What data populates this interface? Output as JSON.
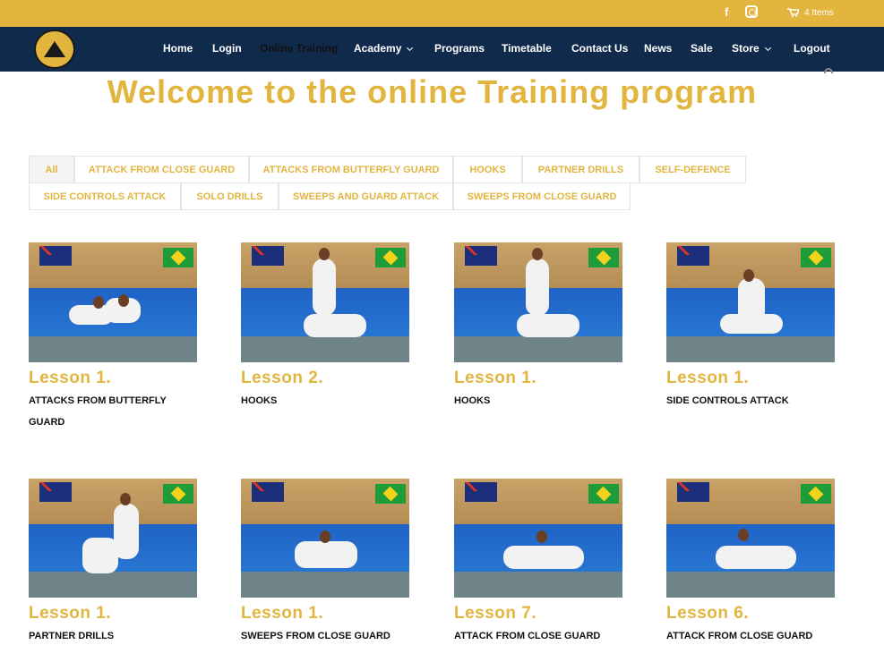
{
  "topbar": {
    "cart_text": "4 Items",
    "icons": [
      "facebook-icon",
      "instagram-icon",
      "cart-icon"
    ]
  },
  "nav": {
    "items": [
      {
        "label": "Home",
        "has_dropdown": false,
        "active": false
      },
      {
        "label": "Login",
        "has_dropdown": false,
        "active": false
      },
      {
        "label": "Online Training",
        "has_dropdown": false,
        "active": true
      },
      {
        "label": "Academy",
        "has_dropdown": true,
        "active": false
      },
      {
        "label": "Programs",
        "has_dropdown": false,
        "active": false
      },
      {
        "label": "Timetable",
        "has_dropdown": false,
        "active": false
      },
      {
        "label": "Contact Us",
        "has_dropdown": false,
        "active": false
      },
      {
        "label": "News",
        "has_dropdown": false,
        "active": false
      },
      {
        "label": "Sale",
        "has_dropdown": false,
        "active": false
      },
      {
        "label": "Store",
        "has_dropdown": true,
        "active": false
      },
      {
        "label": "Logout",
        "has_dropdown": false,
        "active": false
      }
    ]
  },
  "page_title": "Welcome to the online Training program",
  "filters": [
    {
      "label": "All",
      "active": true
    },
    {
      "label": "ATTACK FROM CLOSE GUARD",
      "active": false
    },
    {
      "label": "ATTACKS FROM BUTTERFLY GUARD",
      "active": false
    },
    {
      "label": "HOOKS",
      "active": false
    },
    {
      "label": "PARTNER DRILLS",
      "active": false
    },
    {
      "label": "SELF-DEFENCE",
      "active": false
    },
    {
      "label": "SIDE CONTROLS ATTACK",
      "active": false
    },
    {
      "label": "SOLO DRILLS",
      "active": false
    },
    {
      "label": "SWEEPS AND GUARD ATTACK",
      "active": false
    },
    {
      "label": "SWEEPS FROM CLOSE GUARD",
      "active": false
    }
  ],
  "lessons": [
    {
      "title": "Lesson 1.",
      "category": "ATTACKS FROM BUTTERFLY GUARD"
    },
    {
      "title": "Lesson 2.",
      "category": "HOOKS"
    },
    {
      "title": "Lesson 1.",
      "category": "HOOKS"
    },
    {
      "title": "Lesson 1.",
      "category": "SIDE CONTROLS ATTACK"
    },
    {
      "title": "Lesson 1.",
      "category": "PARTNER DRILLS"
    },
    {
      "title": "Lesson 1.",
      "category": "SWEEPS FROM CLOSE GUARD"
    },
    {
      "title": "Lesson 7.",
      "category": "ATTACK FROM CLOSE GUARD"
    },
    {
      "title": "Lesson 6.",
      "category": "ATTACK FROM CLOSE GUARD"
    }
  ],
  "colors": {
    "accent": "#e2b53f",
    "nav_bg": "#102a4c"
  }
}
